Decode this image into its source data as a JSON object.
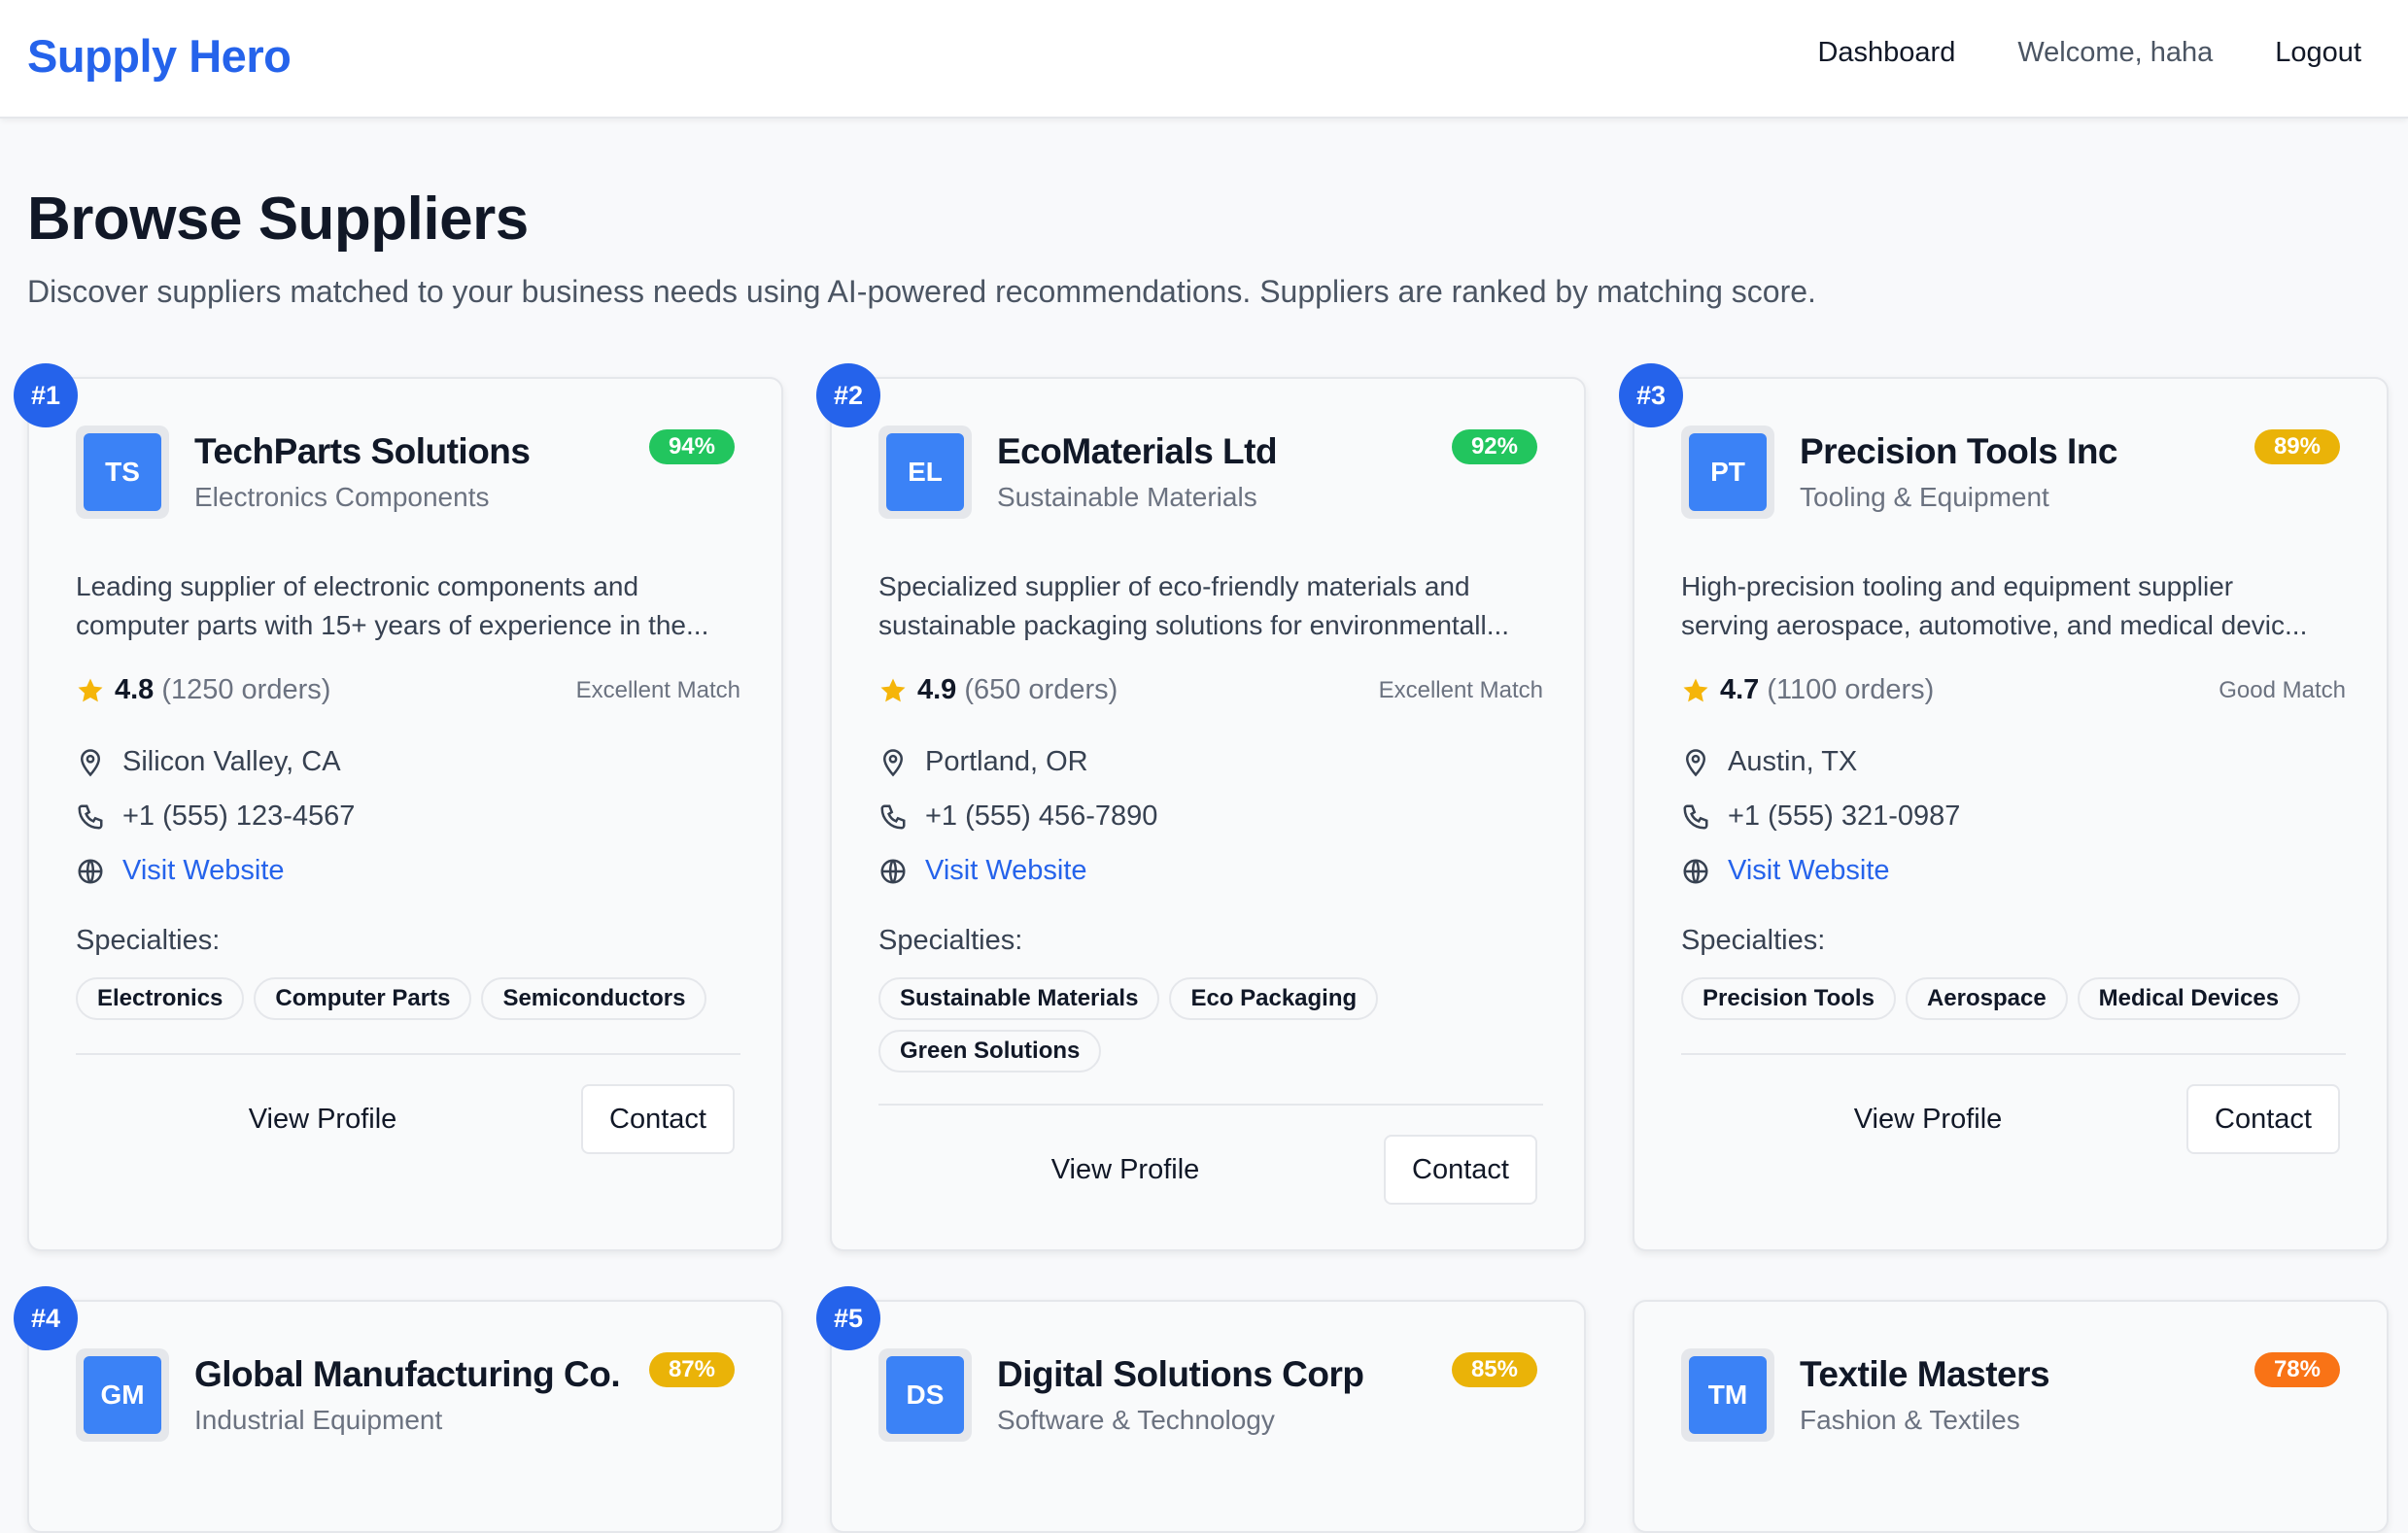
{
  "nav": {
    "brand": "Supply Hero",
    "dashboard": "Dashboard",
    "welcome": "Welcome, haha",
    "logout": "Logout"
  },
  "page": {
    "title": "Browse Suppliers",
    "subtitle": "Discover suppliers matched to your business needs using AI-powered recommendations. Suppliers are ranked by matching score."
  },
  "colors": {
    "accent": "#2563eb",
    "score_green": "#22c55e",
    "score_yellow": "#eab308",
    "score_orange": "#f97316",
    "star": "#f5b50a"
  },
  "labels": {
    "specialties": "Specialties:",
    "view_profile": "View Profile",
    "contact": "Contact",
    "visit_website": "Visit Website"
  },
  "suppliers": [
    {
      "rank": "#1",
      "initials": "TS",
      "name": "TechParts Solutions",
      "category": "Electronics Components",
      "score": "94%",
      "score_color": "green",
      "desc1": "Leading supplier of electronic components and",
      "desc2": "computer parts with 15+ years of experience in the...",
      "rating": "4.8",
      "orders": "(1250 orders)",
      "match": "Excellent Match",
      "location": "Silicon Valley, CA",
      "phone": "+1 (555) 123-4567",
      "specialties": [
        "Electronics",
        "Computer Parts",
        "Semiconductors"
      ]
    },
    {
      "rank": "#2",
      "initials": "EL",
      "name": "EcoMaterials Ltd",
      "category": "Sustainable Materials",
      "score": "92%",
      "score_color": "green",
      "desc1": "Specialized supplier of eco-friendly materials and",
      "desc2": "sustainable packaging solutions for environmentall...",
      "rating": "4.9",
      "orders": "(650 orders)",
      "match": "Excellent Match",
      "location": "Portland, OR",
      "phone": "+1 (555) 456-7890",
      "specialties": [
        "Sustainable Materials",
        "Eco Packaging",
        "Green Solutions"
      ]
    },
    {
      "rank": "#3",
      "initials": "PT",
      "name": "Precision Tools Inc",
      "category": "Tooling & Equipment",
      "score": "89%",
      "score_color": "yellow",
      "desc1": "High-precision tooling and equipment supplier",
      "desc2": "serving aerospace, automotive, and medical devic...",
      "rating": "4.7",
      "orders": "(1100 orders)",
      "match": "Good Match",
      "location": "Austin, TX",
      "phone": "+1 (555) 321-0987",
      "specialties": [
        "Precision Tools",
        "Aerospace",
        "Medical Devices"
      ]
    },
    {
      "rank": "#4",
      "initials": "GM",
      "name": "Global Manufacturing Co.",
      "category": "Industrial Equipment",
      "score": "87%",
      "score_color": "yellow"
    },
    {
      "rank": "#5",
      "initials": "DS",
      "name": "Digital Solutions Corp",
      "category": "Software & Technology",
      "score": "85%",
      "score_color": "yellow"
    },
    {
      "rank": "",
      "initials": "TM",
      "name": "Textile Masters",
      "category": "Fashion & Textiles",
      "score": "78%",
      "score_color": "orange"
    }
  ]
}
